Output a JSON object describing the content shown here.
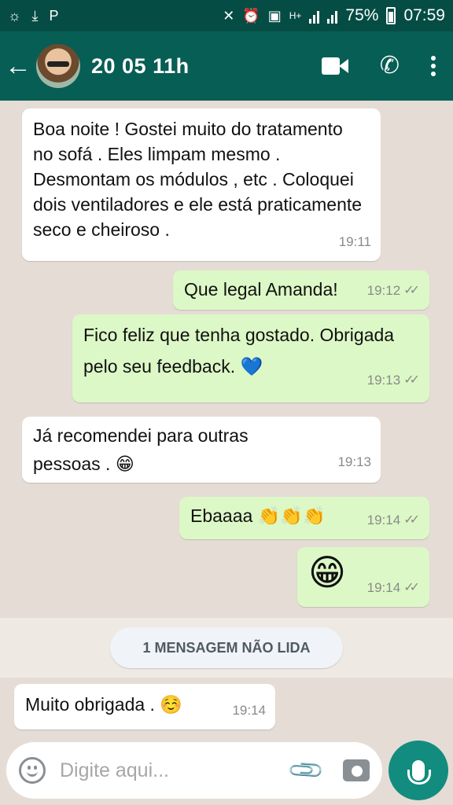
{
  "status_bar": {
    "battery": "75%",
    "time": "07:59",
    "network": "H+"
  },
  "header": {
    "title": "20 05 11h",
    "avatar_icon": "contact-avatar"
  },
  "messages": [
    {
      "dir": "in",
      "text": "Boa noite ! Gostei muito do tratamento no sofá . Eles limpam mesmo . Desmontam os módulos , etc .  Coloquei dois ventiladores e ele está praticamente seco e cheiroso .",
      "time": "19:11"
    },
    {
      "dir": "out",
      "text": "Que legal Amanda!",
      "time": "19:12"
    },
    {
      "dir": "out",
      "text": "Fico feliz que tenha gostado. Obrigada pelo seu feedback. 💙",
      "time": "19:13"
    },
    {
      "dir": "in",
      "text": "Já recomendei para outras pessoas . 😁",
      "time": "19:13"
    },
    {
      "dir": "out",
      "text": "Ebaaaa 👏👏👏",
      "time": "19:14"
    },
    {
      "dir": "out",
      "text": "😁",
      "time": "19:14"
    },
    {
      "dir": "in",
      "text": "Muito obrigada . ☺️",
      "time": "19:14"
    }
  ],
  "unread_banner": "1 MENSAGEM NÃO LIDA",
  "composer": {
    "placeholder": "Digite aqui..."
  },
  "colors": {
    "header": "#075e54",
    "status_bar": "#054d44",
    "outgoing_bubble": "#dcf8c6",
    "incoming_bubble": "#ffffff",
    "mic_button": "#128c7e"
  }
}
